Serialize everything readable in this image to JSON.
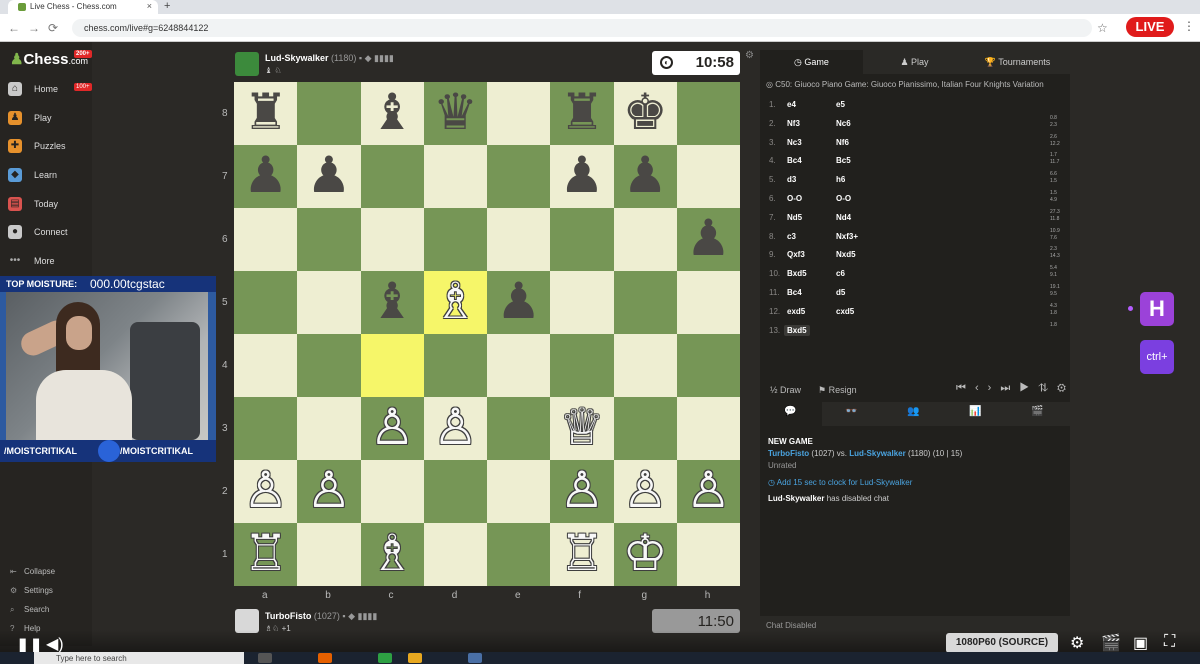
{
  "browser": {
    "tab_title": "Live Chess - Chess.com",
    "close_glyph": "×",
    "new_tab_glyph": "+",
    "back_glyph": "←",
    "forward_glyph": "→",
    "reload_glyph": "⟳",
    "url": "chess.com/live#g=6248844122",
    "star_glyph": "☆",
    "menu_glyph": "⋮"
  },
  "stream_badge": "LIVE",
  "sidebar": {
    "logo_text": "Chess",
    "logo_suffix": ".com",
    "logo_badge": "200+",
    "items": [
      {
        "label": "Home",
        "icon": "home-icon",
        "glyph": "⌂",
        "badge": "100+",
        "color": "#c9c9c9"
      },
      {
        "label": "Play",
        "icon": "play-icon",
        "glyph": "♟",
        "badge": "",
        "color": "#e6912c"
      },
      {
        "label": "Puzzles",
        "icon": "puzzle-icon",
        "glyph": "✚",
        "badge": "",
        "color": "#e6912c"
      },
      {
        "label": "Learn",
        "icon": "learn-icon",
        "glyph": "◆",
        "badge": "",
        "color": "#5a9bd6"
      },
      {
        "label": "Today",
        "icon": "today-icon",
        "glyph": "▤",
        "badge": "",
        "color": "#d9534f"
      },
      {
        "label": "Connect",
        "icon": "connect-icon",
        "glyph": "●",
        "badge": "",
        "color": "#c9c9c9"
      },
      {
        "label": "More",
        "icon": "more-icon",
        "glyph": "•••",
        "badge": "",
        "color": "transparent"
      }
    ],
    "bottom": [
      {
        "label": "Collapse",
        "icon": "collapse-icon",
        "glyph": "⇤"
      },
      {
        "label": "Settings",
        "icon": "settings-icon",
        "glyph": "⚙"
      },
      {
        "label": "Search",
        "icon": "search-icon",
        "glyph": "⌕"
      },
      {
        "label": "Help",
        "icon": "help-icon",
        "glyph": "?"
      }
    ]
  },
  "webcam": {
    "top_label": "TOP MOISTURE:",
    "top_ticker": "000.00tcgstac",
    "handle_left": "/MOISTCRITIKAL",
    "handle_right": "/MOISTCRITIKAL"
  },
  "top_player": {
    "name": "Lud-Skywalker",
    "rating": "(1180)",
    "flags": "▪ ◆ ▮▮▮▮",
    "sub": "♝ ♘",
    "clock": "10:58",
    "clock_icon": "◐",
    "settings_glyph": "⚙"
  },
  "bottom_player": {
    "name": "TurboFisto",
    "rating": "(1027)",
    "flags": "▪ ◆ ▮▮▮▮",
    "sub": "♗♘ +1",
    "clock": "11:50"
  },
  "board": {
    "files": [
      "a",
      "b",
      "c",
      "d",
      "e",
      "f",
      "g",
      "h"
    ],
    "ranks": [
      "8",
      "7",
      "6",
      "5",
      "4",
      "3",
      "2",
      "1"
    ],
    "highlights": [
      "c4",
      "d5"
    ],
    "pieces": [
      {
        "sq": "a8",
        "g": "♜",
        "c": "b"
      },
      {
        "sq": "c8",
        "g": "♝",
        "c": "b"
      },
      {
        "sq": "d8",
        "g": "♛",
        "c": "b"
      },
      {
        "sq": "f8",
        "g": "♜",
        "c": "b"
      },
      {
        "sq": "g8",
        "g": "♚",
        "c": "b"
      },
      {
        "sq": "a7",
        "g": "♟",
        "c": "b"
      },
      {
        "sq": "b7",
        "g": "♟",
        "c": "b"
      },
      {
        "sq": "f7",
        "g": "♟",
        "c": "b"
      },
      {
        "sq": "g7",
        "g": "♟",
        "c": "b"
      },
      {
        "sq": "h6",
        "g": "♟",
        "c": "b"
      },
      {
        "sq": "c5",
        "g": "♝",
        "c": "b"
      },
      {
        "sq": "d5",
        "g": "♗",
        "c": "w"
      },
      {
        "sq": "e5",
        "g": "♟",
        "c": "b"
      },
      {
        "sq": "c3",
        "g": "♙",
        "c": "w"
      },
      {
        "sq": "d3",
        "g": "♙",
        "c": "w"
      },
      {
        "sq": "f3",
        "g": "♕",
        "c": "w"
      },
      {
        "sq": "a2",
        "g": "♙",
        "c": "w"
      },
      {
        "sq": "b2",
        "g": "♙",
        "c": "w"
      },
      {
        "sq": "f2",
        "g": "♙",
        "c": "w"
      },
      {
        "sq": "g2",
        "g": "♙",
        "c": "w"
      },
      {
        "sq": "h2",
        "g": "♙",
        "c": "w"
      },
      {
        "sq": "a1",
        "g": "♖",
        "c": "w"
      },
      {
        "sq": "c1",
        "g": "♗",
        "c": "w"
      },
      {
        "sq": "f1",
        "g": "♖",
        "c": "w"
      },
      {
        "sq": "g1",
        "g": "♔",
        "c": "w"
      }
    ]
  },
  "panel": {
    "tabs": [
      {
        "label": "Game",
        "icon": "clock-icon",
        "glyph": "◷"
      },
      {
        "label": "Play",
        "icon": "pawn-icon",
        "glyph": "♟"
      },
      {
        "label": "Tournaments",
        "icon": "trophy-icon",
        "glyph": "🏆"
      }
    ],
    "opening_icon": "◎",
    "opening": "C50: Giuoco Piano Game: Giuoco Pianissimo, Italian Four Knights Variation",
    "moves": [
      {
        "n": "1.",
        "w": "e4",
        "b": "e5",
        "tw": "",
        "tb": "",
        "vw": 0,
        "vb": 0
      },
      {
        "n": "2.",
        "w": "Nf3",
        "b": "Nc6",
        "tw": "0.8",
        "tb": "2.3",
        "vw": 0.8,
        "vb": 2.3
      },
      {
        "n": "3.",
        "w": "Nc3",
        "b": "Nf6",
        "tw": "2.6",
        "tb": "12.2",
        "vw": 2.6,
        "vb": 12.2
      },
      {
        "n": "4.",
        "w": "Bc4",
        "b": "Bc5",
        "tw": "1.7",
        "tb": "11.7",
        "vw": 1.7,
        "vb": 11.7
      },
      {
        "n": "5.",
        "w": "d3",
        "b": "h6",
        "tw": "6.6",
        "tb": "1.5",
        "vw": 6.6,
        "vb": 1.5
      },
      {
        "n": "6.",
        "w": "O-O",
        "b": "O-O",
        "tw": "1.5",
        "tb": "4.9",
        "vw": 1.5,
        "vb": 4.9
      },
      {
        "n": "7.",
        "w": "Nd5",
        "b": "Nd4",
        "tw": "27.3",
        "tb": "11.8",
        "vw": 27.3,
        "vb": 11.8
      },
      {
        "n": "8.",
        "w": "c3",
        "b": "Nxf3+",
        "tw": "10.9",
        "tb": "7.6",
        "vw": 10.9,
        "vb": 7.6
      },
      {
        "n": "9.",
        "w": "Qxf3",
        "b": "Nxd5",
        "tw": "2.3",
        "tb": "14.3",
        "vw": 2.3,
        "vb": 14.3
      },
      {
        "n": "10.",
        "w": "Bxd5",
        "b": "c6",
        "tw": "5.4",
        "tb": "9.1",
        "vw": 5.4,
        "vb": 9.1
      },
      {
        "n": "11.",
        "w": "Bc4",
        "b": "d5",
        "tw": "19.1",
        "tb": "9.5",
        "vw": 19.1,
        "vb": 9.5
      },
      {
        "n": "12.",
        "w": "exd5",
        "b": "cxd5",
        "tw": "4.3",
        "tb": "1.8",
        "vw": 4.3,
        "vb": 1.8
      },
      {
        "n": "13.",
        "w": "Bxd5",
        "b": "",
        "tw": "1.8",
        "tb": "",
        "vw": 1.8,
        "vb": 0
      }
    ],
    "draw_label": "½ Draw",
    "resign_label": "Resign",
    "resign_glyph": "⚑",
    "nav_glyphs": "⏮ ‹ › ⏭ ▶ ⇅ ⚙",
    "chat_tabs": [
      "💬",
      "👓",
      "👥",
      "📊",
      "🎬"
    ],
    "chat": {
      "title": "NEW GAME",
      "white": "TurboFisto",
      "white_rating": "(1027) vs.",
      "black": "Lud-Skywalker",
      "black_rating": "(1180) (10 | 15)",
      "type": "Unrated",
      "add_time": "Add 15 sec to clock for Lud-Skywalker",
      "add_icon": "◷",
      "disabled_user": "Lud-Skywalker",
      "disabled_msg": "has disabled chat",
      "input_placeholder": "Chat Disabled"
    }
  },
  "extensions": {
    "h_label": "H",
    "ctrl_label": "ctrl+"
  },
  "player": {
    "quality": "1080P60 (SOURCE)",
    "pause_glyph": "❚❚",
    "volume_glyph": "◀)",
    "settings_glyph": "⚙",
    "clip_glyph": "🎬",
    "theater_glyph": "▣",
    "fullscreen_glyph": "⛶"
  },
  "taskbar": {
    "search_placeholder": "Type here to search"
  }
}
